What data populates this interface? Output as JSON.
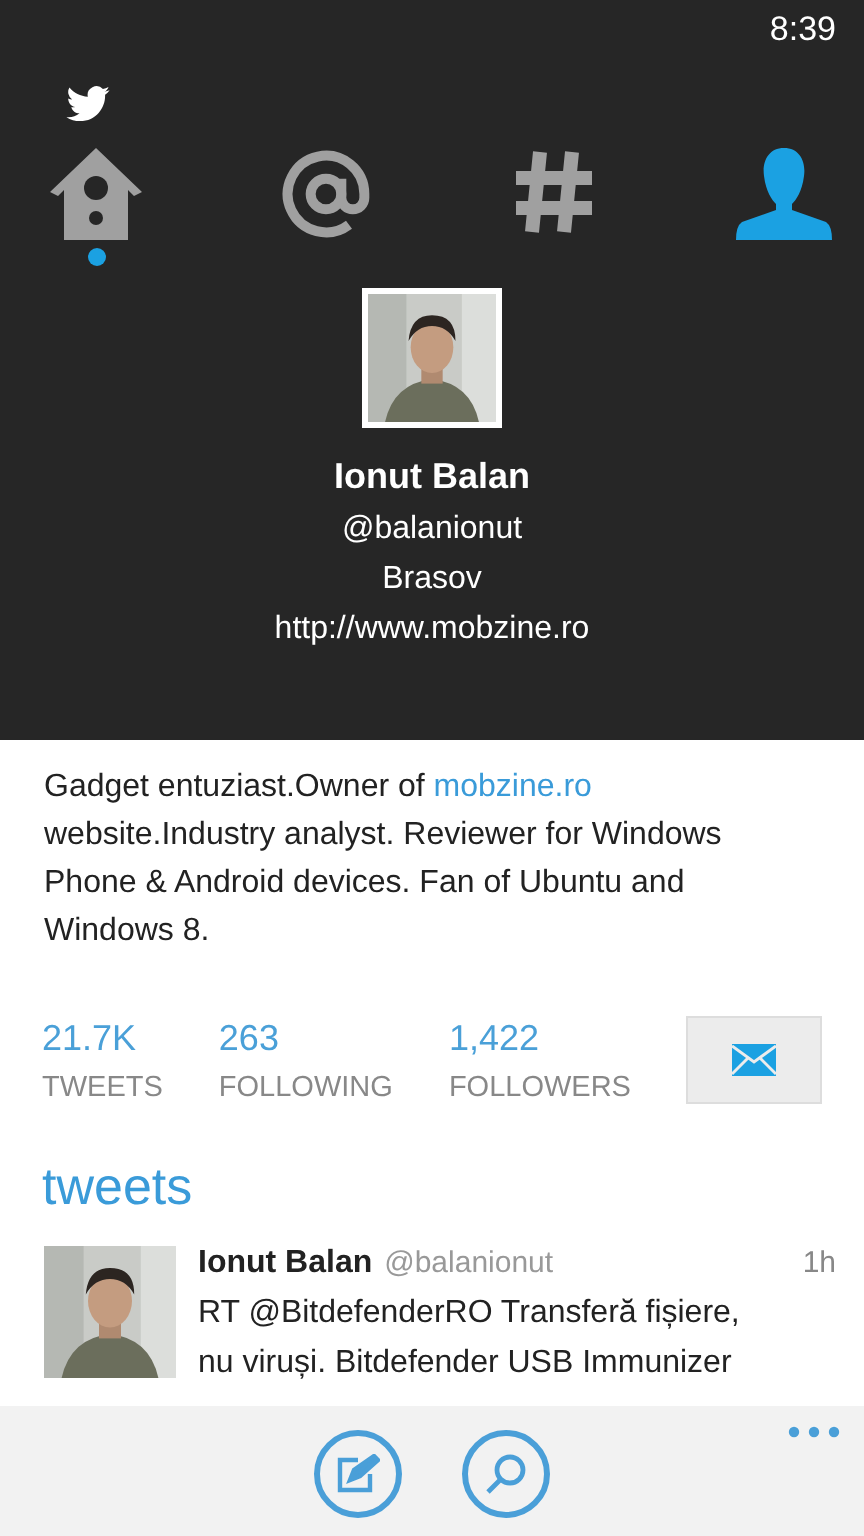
{
  "status_bar": {
    "time": "8:39"
  },
  "tabs": [
    {
      "kind": "home",
      "selected": false,
      "has_new": true
    },
    {
      "kind": "mentions",
      "selected": false,
      "has_new": false
    },
    {
      "kind": "hashtags",
      "selected": false,
      "has_new": false
    },
    {
      "kind": "profile",
      "selected": true,
      "has_new": false
    }
  ],
  "profile": {
    "avatar": {
      "kind": "picture"
    },
    "name": "Ionut Balan",
    "handle": "@balanionut",
    "location": "Brasov",
    "url": "http://www.mobzine.ro"
  },
  "bio": {
    "before": "Gadget entuziast.Owner of ",
    "link": "mobzine.ro",
    "after": " website.Industry analyst. Reviewer for Windows Phone & Android devices. Fan of Ubuntu and Windows 8."
  },
  "stats": [
    {
      "value": "21.7K",
      "label": "TWEETS"
    },
    {
      "value": "263",
      "label": "FOLLOWING"
    },
    {
      "value": "1,422",
      "label": "FOLLOWERS"
    }
  ],
  "section_title": "tweets",
  "tweets": [
    {
      "avatar": {
        "kind": "picture"
      },
      "name": "Ionut Balan",
      "handle": "@balanionut",
      "time": "1h",
      "lines": [
        "RT @BitdefenderRO Transferă fișiere,",
        "nu viruși. Bitdefender USB Immunizer"
      ]
    }
  ],
  "app_bar": {
    "buttons": [
      {
        "kind": "compose"
      },
      {
        "kind": "search"
      }
    ]
  }
}
